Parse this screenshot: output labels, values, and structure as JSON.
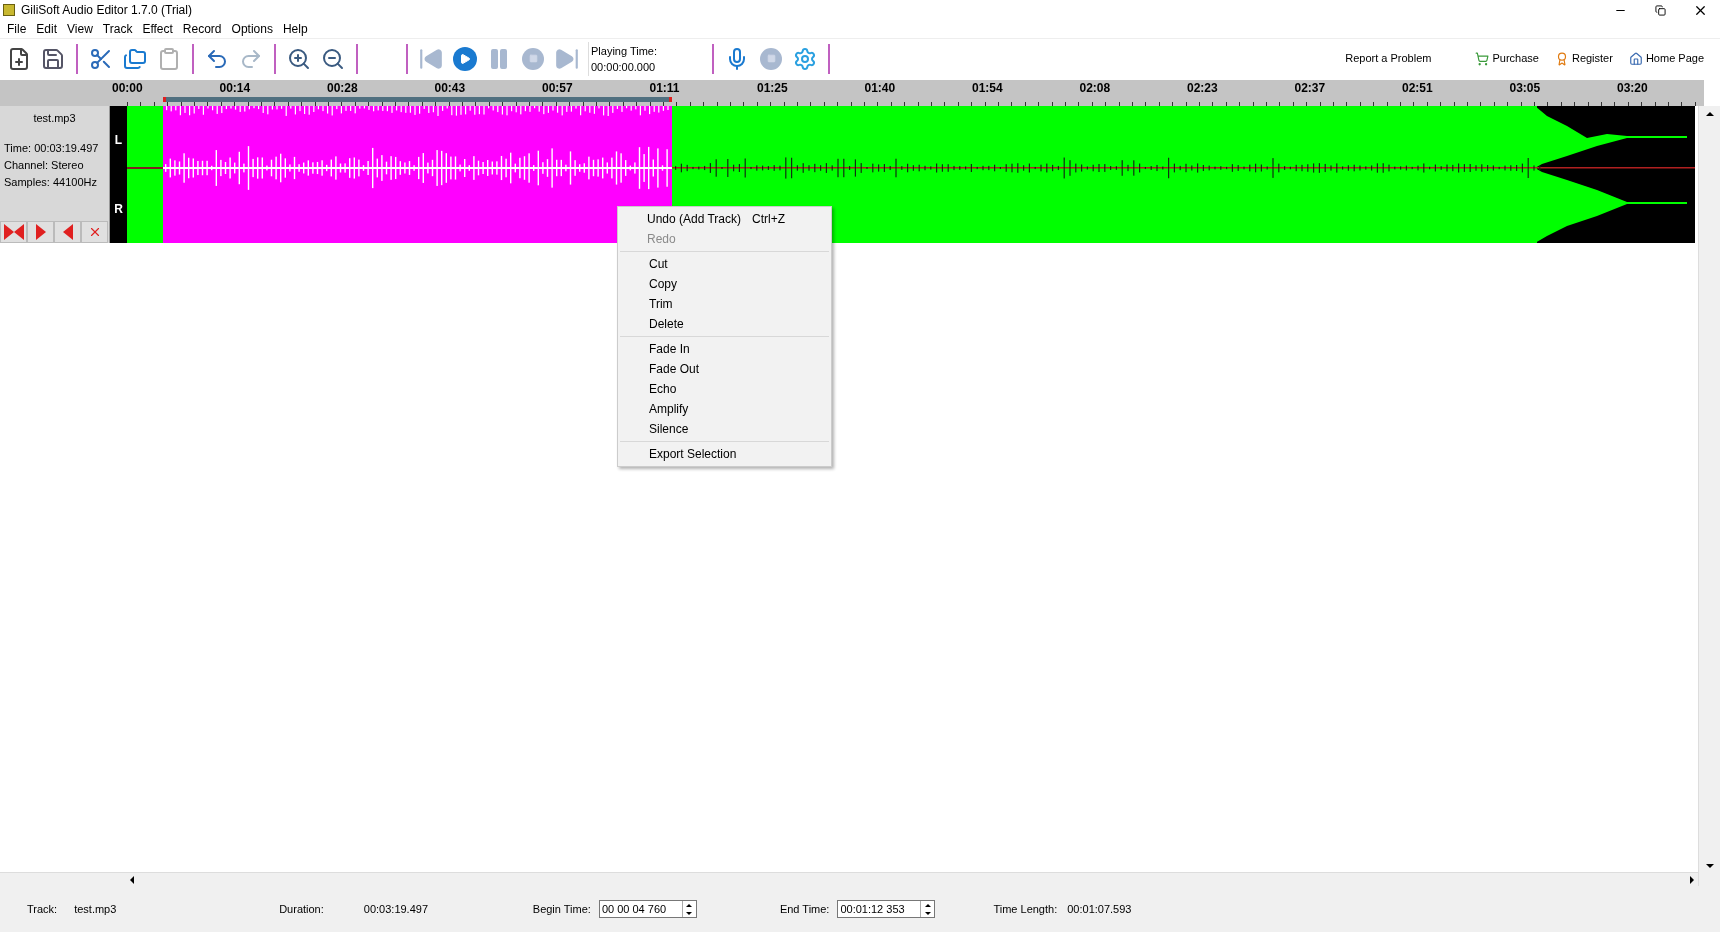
{
  "window": {
    "title": "GiliSoft Audio Editor 1.7.0 (Trial)"
  },
  "menu": [
    "File",
    "Edit",
    "View",
    "Track",
    "Effect",
    "Record",
    "Options",
    "Help"
  ],
  "toolbar": {
    "playing_time": {
      "label": "Playing Time:",
      "value": "00:00:00.000"
    },
    "links": [
      {
        "kind": "plain",
        "label": "Report a Problem"
      },
      {
        "kind": "cart",
        "label": "Purchase"
      },
      {
        "kind": "badge",
        "label": "Register"
      },
      {
        "kind": "home",
        "label": "Home Page"
      }
    ]
  },
  "ruler": [
    "00:00",
    "00:14",
    "00:28",
    "00:43",
    "00:57",
    "01:11",
    "01:25",
    "01:40",
    "01:54",
    "02:08",
    "02:23",
    "02:37",
    "02:51",
    "03:05",
    "03:20"
  ],
  "track": {
    "name": "test.mp3",
    "info": [
      "Time: 00:03:19.497",
      "Channel: Stereo",
      "Samples: 44100Hz"
    ],
    "channels": [
      "L",
      "R"
    ]
  },
  "context_menu": [
    [
      {
        "label": "Undo (Add Track)",
        "shortcut": "Ctrl+Z",
        "disabled": false
      },
      {
        "label": "Redo",
        "disabled": true
      }
    ],
    [
      {
        "label": "Cut",
        "disabled": false
      },
      {
        "label": "Copy",
        "disabled": false
      },
      {
        "label": "Trim",
        "disabled": false
      },
      {
        "label": "Delete",
        "disabled": false
      }
    ],
    [
      {
        "label": "Fade In",
        "disabled": false
      },
      {
        "label": "Fade Out",
        "disabled": false
      },
      {
        "label": "Echo",
        "disabled": false
      },
      {
        "label": "Amplify",
        "disabled": false
      },
      {
        "label": "Silence",
        "disabled": false
      }
    ],
    [
      {
        "label": "Export Selection",
        "disabled": false
      }
    ]
  ],
  "status_bar": {
    "track": {
      "label": "Track:",
      "value": "test.mp3"
    },
    "duration": {
      "label": "Duration:",
      "value": "00:03:19.497"
    },
    "begin_time": {
      "label": "Begin Time:",
      "value": "00 00 04 760"
    },
    "end_time": {
      "label": "End Time:",
      "value": "00:01:12 353"
    },
    "time_length": {
      "label": "Time Length:",
      "value": "00:01:07.593"
    }
  }
}
